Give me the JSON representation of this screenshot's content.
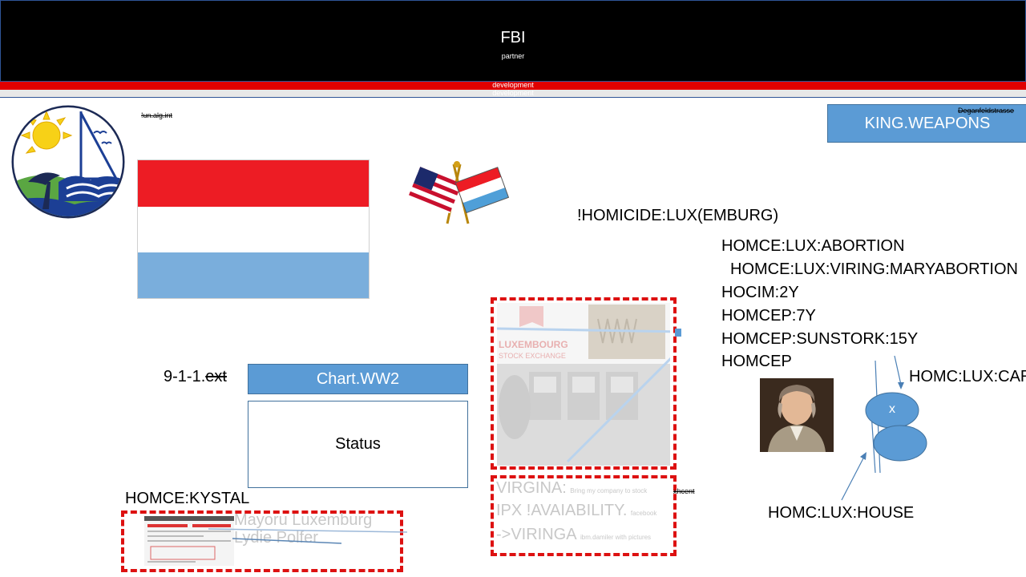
{
  "header": {
    "title": "FBI",
    "subtitle": "partner",
    "bar1_text": "development",
    "bar2_text": "development"
  },
  "top_left_link": "!un.alg.int",
  "top_right_strike": "Deganfeldstrasse",
  "king_weapons_label": "KING.WEAPONS",
  "homicide_heading": "!HOMICIDE:LUX(EMBURG)",
  "homce_lines": [
    "HOMCE:LUX:ABORTION",
    "HOMCE:LUX:VIRING:MARYABORTION",
    "HOCIM:2Y",
    "HOMCEP:7Y",
    "HOMCEP:SUNSTORK:15Y",
    "HOMCEP"
  ],
  "homc_car_label": "HOMC:LUX:CAR",
  "homc_house_label": "HOMC:LUX:HOUSE",
  "node_x_label": "x",
  "emergency_label": "9-1-1.",
  "emergency_ext": "ext",
  "chart_button_label": "Chart.WW2",
  "status_label": "Status",
  "kystal_label": "HOMCE:KYSTAL",
  "mayor_text_1": "Mayoru Luxemburg",
  "mayor_text_2": "Lydie Polfer",
  "stock_exchange_lines": [
    "LUXEMBOURG",
    "STOCK EXCHANGE"
  ],
  "virgina_rows": [
    {
      "big": "VIRGINA:",
      "small": "Bring my company to stock"
    },
    {
      "big": "IPX !AVAIABILITY.",
      "small": "facebook"
    },
    {
      "big": "->VIRINGA",
      "small": "ibm.damiler with pictures"
    }
  ],
  "virgina_strike": "xhcent",
  "colors": {
    "header_bg": "#000000",
    "red_bar": "#e00000",
    "button_blue": "#5b9bd5",
    "dashed_red": "#dd1111",
    "lux_flag_red": "#ed1c24",
    "lux_flag_blue": "#7aaedc"
  }
}
